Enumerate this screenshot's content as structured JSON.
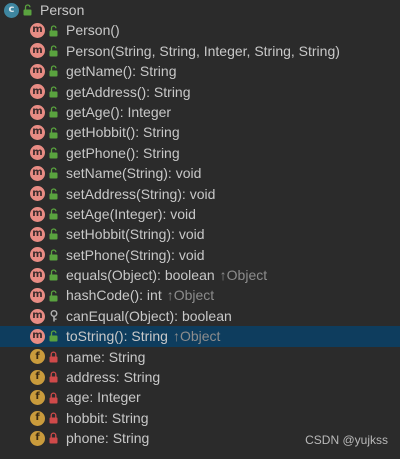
{
  "root": {
    "badge": "c",
    "name": "Person",
    "visibility_icon": "unlock-icon"
  },
  "members": [
    {
      "badge": "m",
      "kind": "method",
      "vis": "unlock",
      "name": "Person()",
      "extra": ""
    },
    {
      "badge": "m",
      "kind": "method",
      "vis": "unlock",
      "name": "Person(String, String, Integer, String, String)",
      "extra": ""
    },
    {
      "badge": "m",
      "kind": "method",
      "vis": "unlock",
      "name": "getName(): String",
      "extra": ""
    },
    {
      "badge": "m",
      "kind": "method",
      "vis": "unlock",
      "name": "getAddress(): String",
      "extra": ""
    },
    {
      "badge": "m",
      "kind": "method",
      "vis": "unlock",
      "name": "getAge(): Integer",
      "extra": ""
    },
    {
      "badge": "m",
      "kind": "method",
      "vis": "unlock",
      "name": "getHobbit(): String",
      "extra": ""
    },
    {
      "badge": "m",
      "kind": "method",
      "vis": "unlock",
      "name": "getPhone(): String",
      "extra": ""
    },
    {
      "badge": "m",
      "kind": "method",
      "vis": "unlock",
      "name": "setName(String): void",
      "extra": ""
    },
    {
      "badge": "m",
      "kind": "method",
      "vis": "unlock",
      "name": "setAddress(String): void",
      "extra": ""
    },
    {
      "badge": "m",
      "kind": "method",
      "vis": "unlock",
      "name": "setAge(Integer): void",
      "extra": ""
    },
    {
      "badge": "m",
      "kind": "method",
      "vis": "unlock",
      "name": "setHobbit(String): void",
      "extra": ""
    },
    {
      "badge": "m",
      "kind": "method",
      "vis": "unlock",
      "name": "setPhone(String): void",
      "extra": ""
    },
    {
      "badge": "m",
      "kind": "method",
      "vis": "unlock",
      "name": "equals(Object): boolean",
      "extra": "↑Object"
    },
    {
      "badge": "m",
      "kind": "method",
      "vis": "unlock",
      "name": "hashCode(): int",
      "extra": "↑Object"
    },
    {
      "badge": "m",
      "kind": "method",
      "vis": "protected",
      "name": "canEqual(Object): boolean",
      "extra": ""
    },
    {
      "badge": "m",
      "kind": "method",
      "vis": "unlock",
      "name": "toString(): String",
      "extra": "↑Object",
      "selected": true
    },
    {
      "badge": "f",
      "kind": "field",
      "vis": "lock",
      "name": "name: String",
      "extra": ""
    },
    {
      "badge": "f",
      "kind": "field",
      "vis": "lock",
      "name": "address: String",
      "extra": ""
    },
    {
      "badge": "f",
      "kind": "field",
      "vis": "lock",
      "name": "age: Integer",
      "extra": ""
    },
    {
      "badge": "f",
      "kind": "field",
      "vis": "lock",
      "name": "hobbit: String",
      "extra": ""
    },
    {
      "badge": "f",
      "kind": "field",
      "vis": "lock",
      "name": "phone: String",
      "extra": ""
    }
  ],
  "watermark": "CSDN @yujkss",
  "colors": {
    "background": "#2b2b2b",
    "selection": "#0e3d5e",
    "class_badge": "#3e86a0",
    "method_badge": "#e88c84",
    "field_badge": "#c99b3c",
    "unlock": "#5aa33f",
    "lock": "#d04a4a"
  }
}
